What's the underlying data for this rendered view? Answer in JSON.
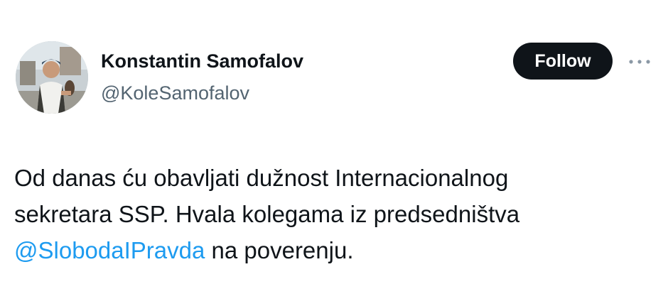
{
  "tweet": {
    "author": {
      "display_name": "Konstantin Samofalov",
      "handle": "@KoleSamofalov",
      "avatar_icon": "profile-photo"
    },
    "follow_label": "Follow",
    "more_icon": "more-horizontal-icon",
    "text_lines": [
      "Od danas ću obavljati dužnost Internacionalnog",
      "sekretara SSP. Hvala kolegama iz predsedništva"
    ],
    "line3": {
      "mention": "@SlobodaIPravda",
      "rest": " na poverenju."
    },
    "colors": {
      "text": "#0f1419",
      "secondary": "#536471",
      "mention": "#1d9bf0",
      "follow_bg": "#0f1419",
      "follow_text": "#ffffff"
    }
  }
}
